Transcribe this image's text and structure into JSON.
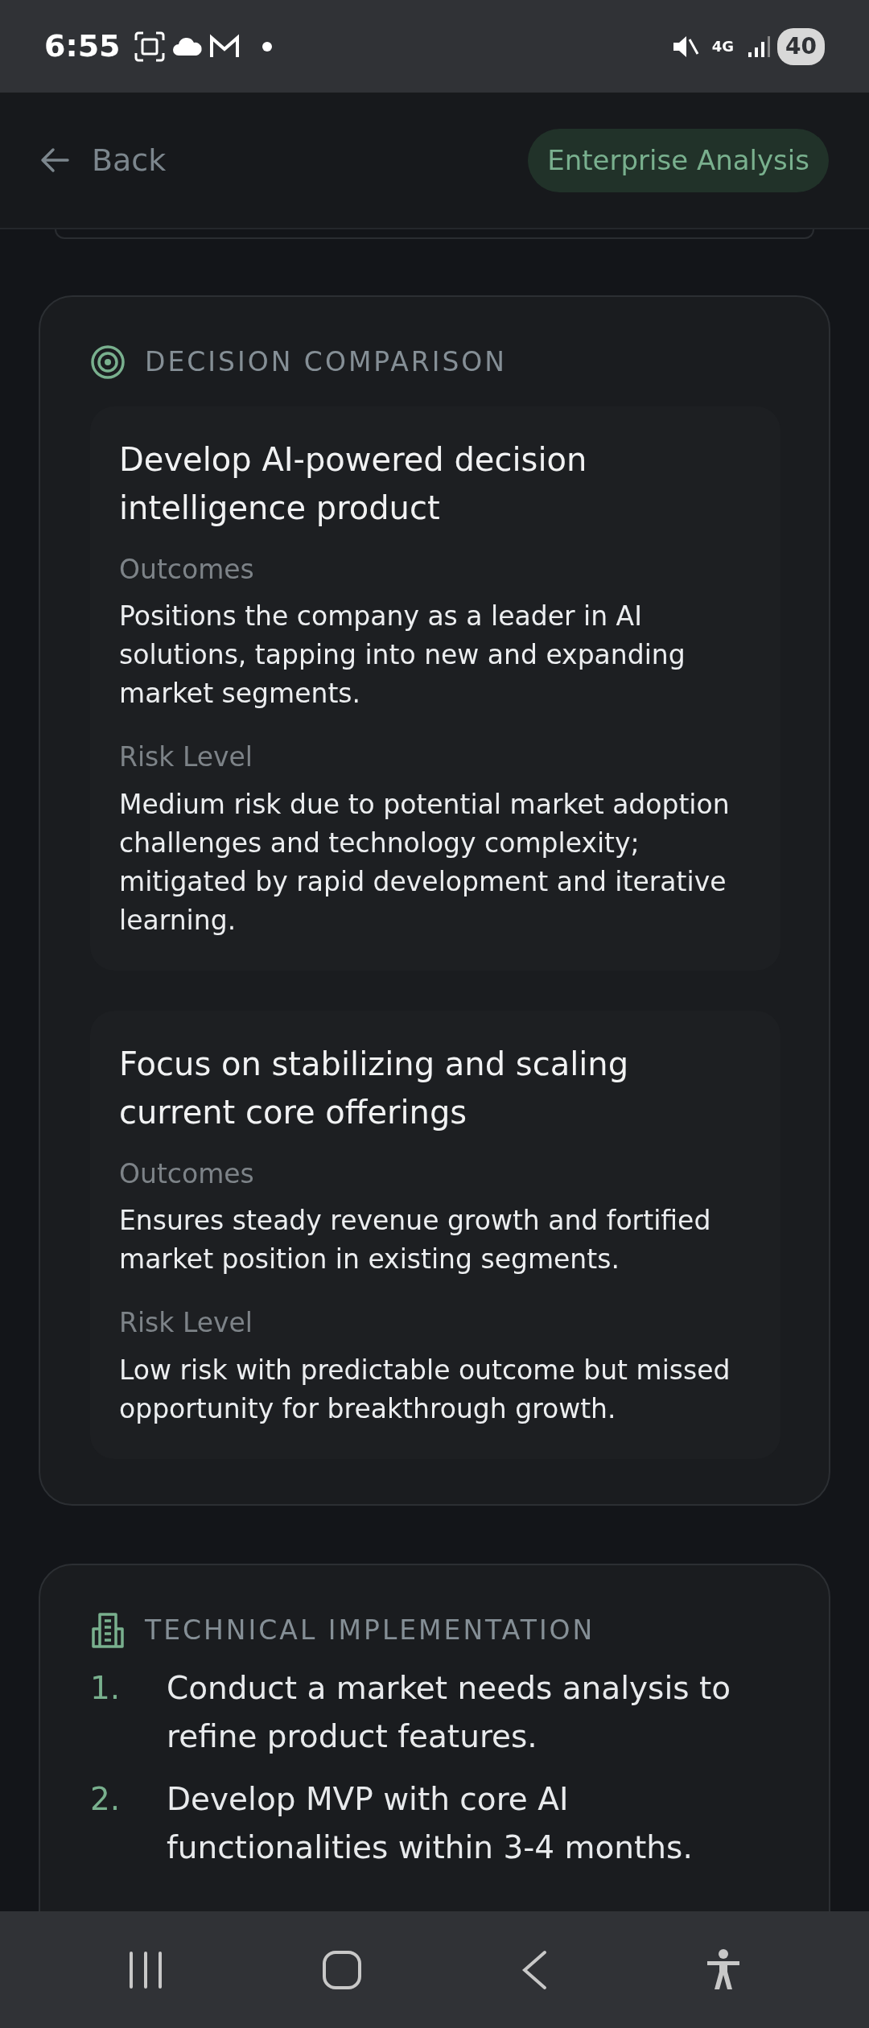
{
  "status_bar": {
    "time": "6:55",
    "network": "4G",
    "battery": "40"
  },
  "header": {
    "back": "Back",
    "badge": "Enterprise Analysis"
  },
  "decision_comparison": {
    "title": "DECISION COMPARISON",
    "options": [
      {
        "title": "Develop AI-powered decision intelligence product",
        "outcomes_label": "Outcomes",
        "outcomes": "Positions the company as a leader in AI solutions, tapping into new and expanding market segments.",
        "risk_label": "Risk Level",
        "risk": "Medium risk due to potential market adoption challenges and technology complexity; mitigated by rapid development and iterative learning."
      },
      {
        "title": "Focus on stabilizing and scaling current core offerings",
        "outcomes_label": "Outcomes",
        "outcomes": "Ensures steady revenue growth and fortified market position in existing segments.",
        "risk_label": "Risk Level",
        "risk": "Low risk with predictable outcome but missed opportunity for breakthrough growth."
      }
    ]
  },
  "technical_implementation": {
    "title": "TECHNICAL IMPLEMENTATION",
    "steps": [
      {
        "number": "1.",
        "text": "Conduct a market needs analysis to refine product features."
      },
      {
        "number": "2.",
        "text": "Develop MVP with core AI functionalities within 3-4 months."
      }
    ]
  }
}
